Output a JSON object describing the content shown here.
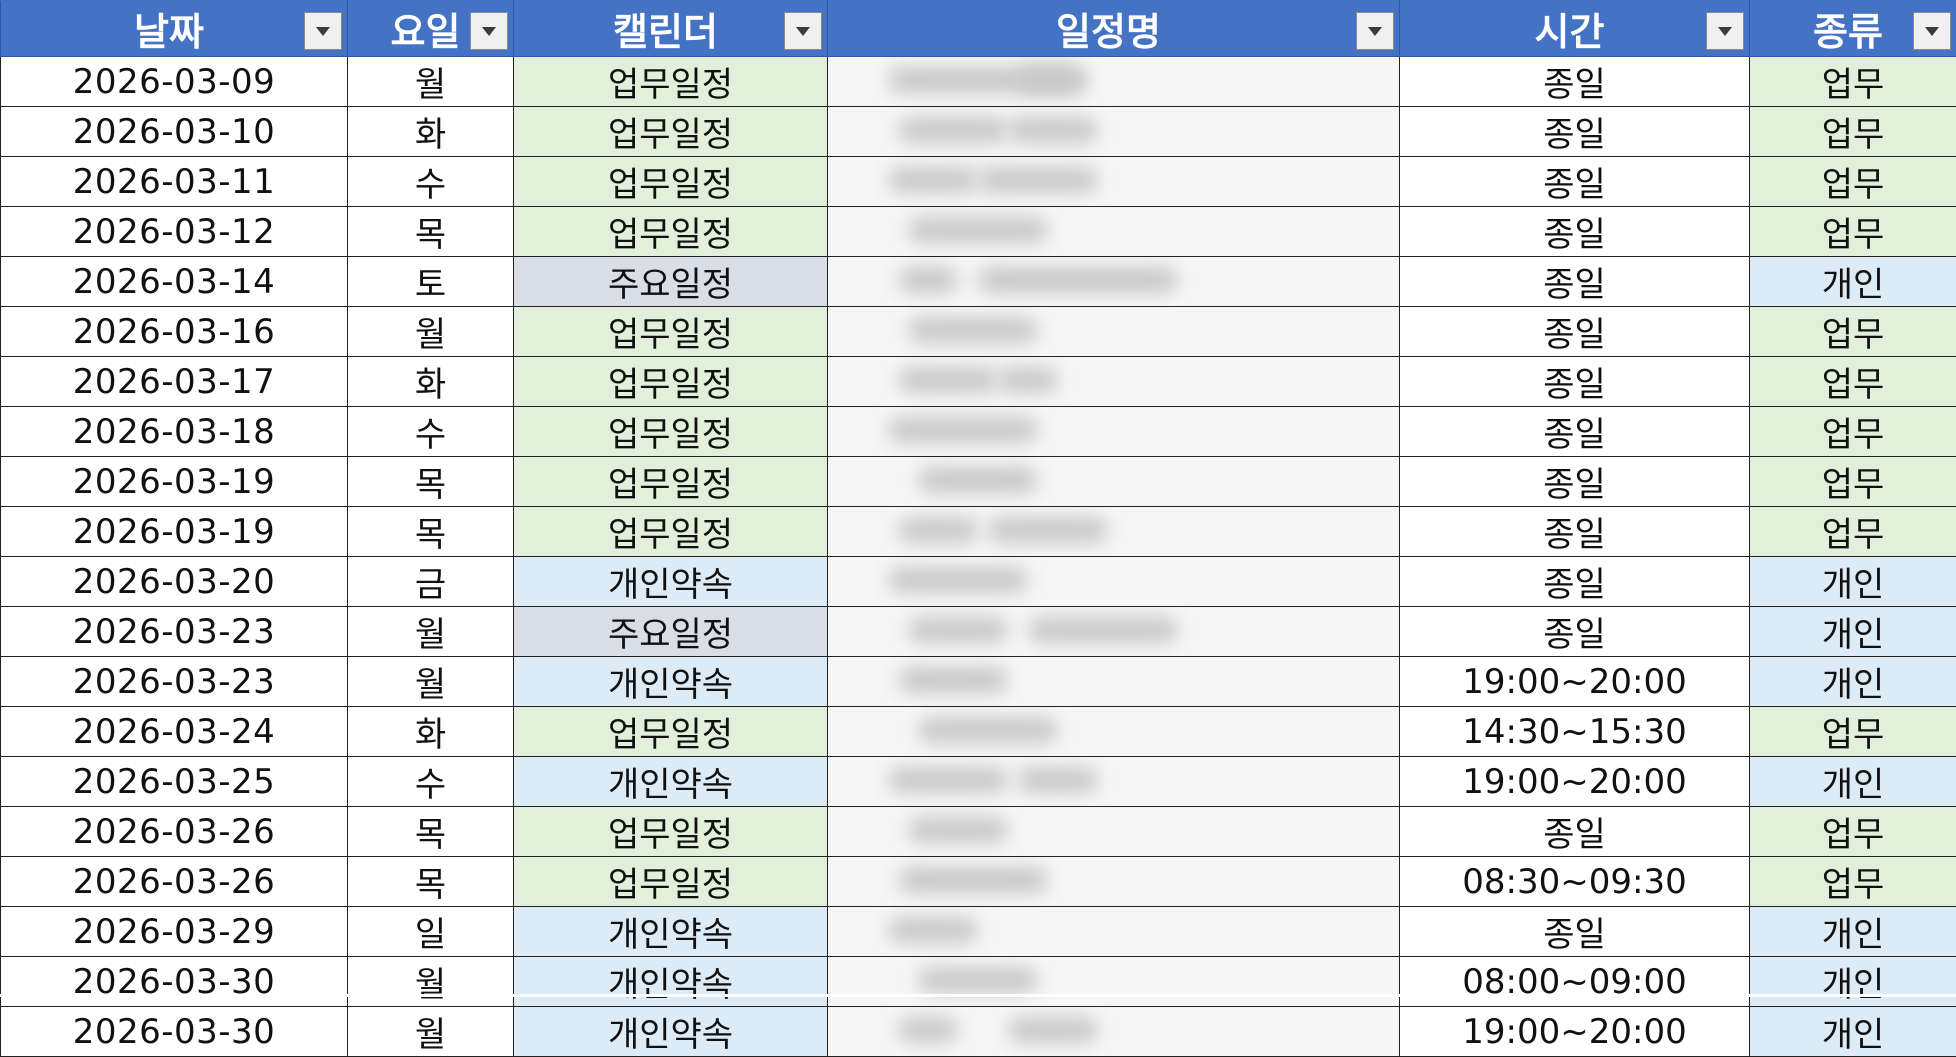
{
  "columns": [
    {
      "label": "날짜",
      "key": "date"
    },
    {
      "label": "요일",
      "key": "weekday"
    },
    {
      "label": "캘린더",
      "key": "calendar"
    },
    {
      "label": "일정명",
      "key": "title"
    },
    {
      "label": "시간",
      "key": "time"
    },
    {
      "label": "종류",
      "key": "category"
    }
  ],
  "icons": {
    "filter": "dropdown-filter-icon"
  },
  "colors": {
    "header_bg": "#4472c4",
    "work_fill": "#e2efda",
    "personal_fill": "#ddebf7",
    "major_fill": "#d9dde6"
  },
  "rows": [
    {
      "date": "2026-03-09",
      "weekday": "월",
      "calendar": "업무일정",
      "time": "종일",
      "category": "업무"
    },
    {
      "date": "2026-03-10",
      "weekday": "화",
      "calendar": "업무일정",
      "time": "종일",
      "category": "업무"
    },
    {
      "date": "2026-03-11",
      "weekday": "수",
      "calendar": "업무일정",
      "time": "종일",
      "category": "업무"
    },
    {
      "date": "2026-03-12",
      "weekday": "목",
      "calendar": "업무일정",
      "time": "종일",
      "category": "업무"
    },
    {
      "date": "2026-03-14",
      "weekday": "토",
      "calendar": "주요일정",
      "time": "종일",
      "category": "개인"
    },
    {
      "date": "2026-03-16",
      "weekday": "월",
      "calendar": "업무일정",
      "time": "종일",
      "category": "업무"
    },
    {
      "date": "2026-03-17",
      "weekday": "화",
      "calendar": "업무일정",
      "time": "종일",
      "category": "업무"
    },
    {
      "date": "2026-03-18",
      "weekday": "수",
      "calendar": "업무일정",
      "time": "종일",
      "category": "업무"
    },
    {
      "date": "2026-03-19",
      "weekday": "목",
      "calendar": "업무일정",
      "time": "종일",
      "category": "업무"
    },
    {
      "date": "2026-03-19",
      "weekday": "목",
      "calendar": "업무일정",
      "time": "종일",
      "category": "업무"
    },
    {
      "date": "2026-03-20",
      "weekday": "금",
      "calendar": "개인약속",
      "time": "종일",
      "category": "개인"
    },
    {
      "date": "2026-03-23",
      "weekday": "월",
      "calendar": "주요일정",
      "time": "종일",
      "category": "개인"
    },
    {
      "date": "2026-03-23",
      "weekday": "월",
      "calendar": "개인약속",
      "time": "19:00~20:00",
      "category": "개인"
    },
    {
      "date": "2026-03-24",
      "weekday": "화",
      "calendar": "업무일정",
      "time": "14:30~15:30",
      "category": "업무"
    },
    {
      "date": "2026-03-25",
      "weekday": "수",
      "calendar": "개인약속",
      "time": "19:00~20:00",
      "category": "개인"
    },
    {
      "date": "2026-03-26",
      "weekday": "목",
      "calendar": "업무일정",
      "time": "종일",
      "category": "업무"
    },
    {
      "date": "2026-03-26",
      "weekday": "목",
      "calendar": "업무일정",
      "time": "08:30~09:30",
      "category": "업무"
    },
    {
      "date": "2026-03-29",
      "weekday": "일",
      "calendar": "개인약속",
      "time": "종일",
      "category": "개인"
    },
    {
      "date": "2026-03-30",
      "weekday": "월",
      "calendar": "개인약속",
      "time": "08:00~09:00",
      "category": "개인"
    },
    {
      "date": "2026-03-30",
      "weekday": "월",
      "calendar": "개인약속",
      "time": "19:00~20:00",
      "category": "개인"
    }
  ]
}
